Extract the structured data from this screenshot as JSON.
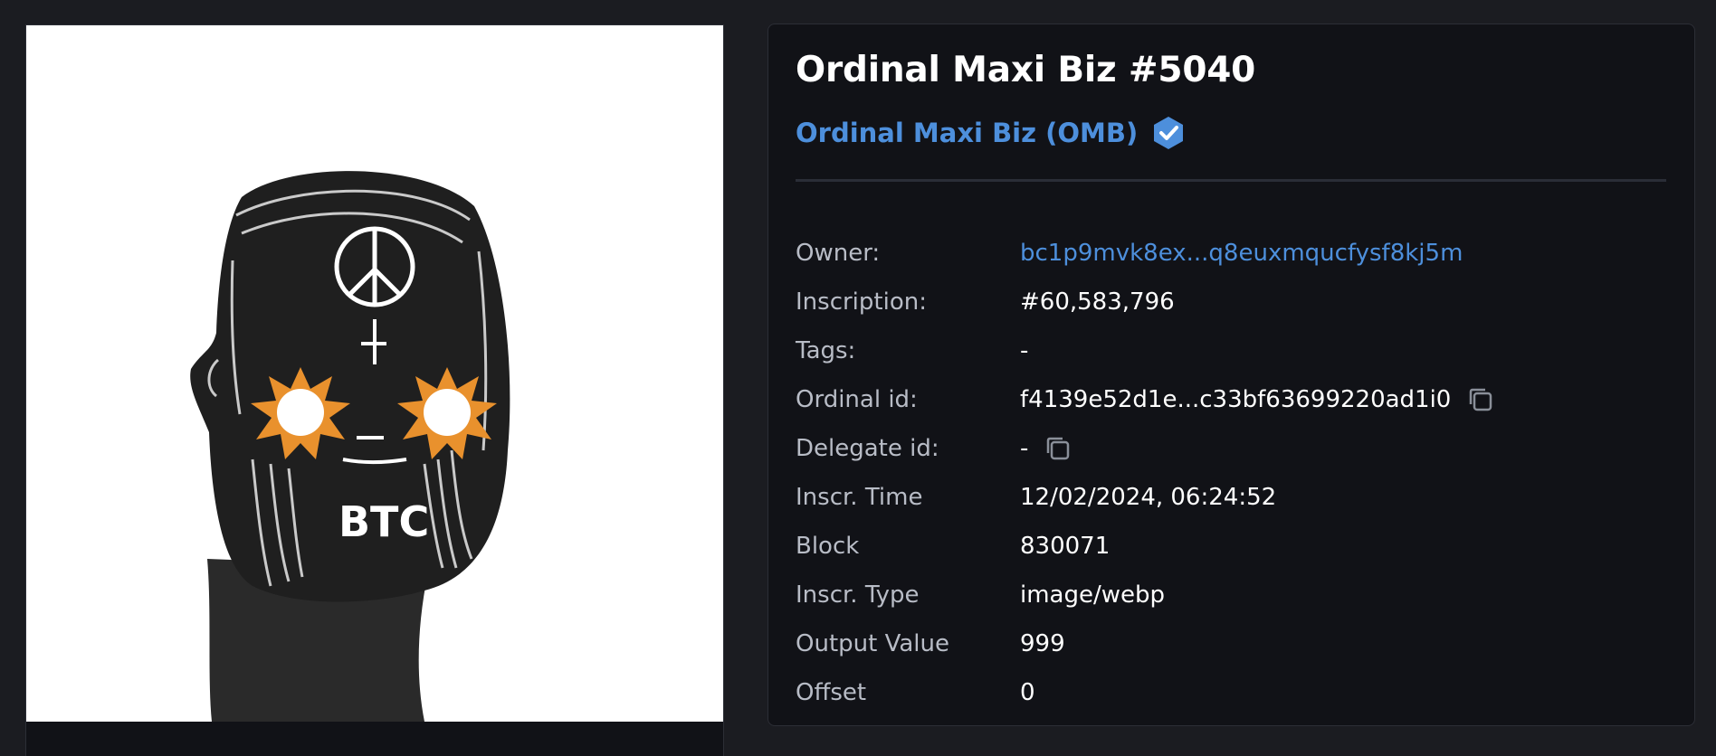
{
  "nft": {
    "title": "Ordinal Maxi Biz #5040",
    "collection_name": "Ordinal Maxi Biz (OMB)",
    "verified_icon": "verified-badge-icon",
    "image_icon": "nft-artwork-image",
    "image_text": "BTC"
  },
  "properties": [
    {
      "label": "Owner:",
      "value": "bc1p9mvk8ex...q8euxmqucfysf8kj5m"
    },
    {
      "label": "Inscription:",
      "value": "#60,583,796"
    },
    {
      "label": "Tags:",
      "value": "-"
    },
    {
      "label": "Ordinal id:",
      "value": "f4139e52d1e...c33bf63699220ad1i0"
    },
    {
      "label": "Delegate id:",
      "value": "-"
    },
    {
      "label": "Inscr. Time",
      "value": "12/02/2024, 06:24:52"
    },
    {
      "label": "Block",
      "value": "830071"
    },
    {
      "label": "Inscr. Type",
      "value": "image/webp"
    },
    {
      "label": "Output Value",
      "value": "999"
    },
    {
      "label": "Offset",
      "value": "0"
    }
  ],
  "colors": {
    "background": "#1b1c21",
    "card": "#111217",
    "accent": "#4d8fdc",
    "label": "#b8bcc6",
    "value": "#ffffff"
  }
}
